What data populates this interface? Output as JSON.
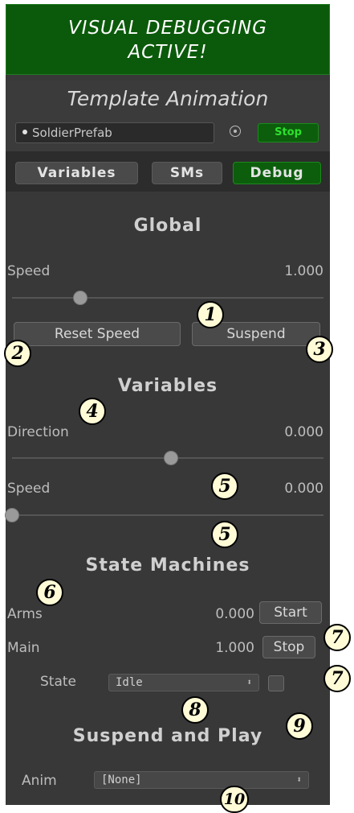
{
  "banner": {
    "line1": "VISUAL DEBUGGING",
    "line2": "ACTIVE!"
  },
  "header": {
    "title": "Template Animation",
    "object_field": "SoldierPrefab",
    "stop_label": "Stop"
  },
  "tabs": [
    {
      "label": "Variables"
    },
    {
      "label": "SMs"
    },
    {
      "label": "Debug",
      "active": true
    }
  ],
  "global": {
    "title": "Global",
    "speed_label": "Speed",
    "speed_value": "1.000",
    "speed_slider_fraction": 0.22,
    "reset_speed_label": "Reset Speed",
    "suspend_label": "Suspend"
  },
  "variables": {
    "title": "Variables",
    "items": [
      {
        "label": "Direction",
        "value": "0.000",
        "slider_fraction": 0.51
      },
      {
        "label": "Speed",
        "value": "0.000",
        "slider_fraction": 0.0
      }
    ]
  },
  "state_machines": {
    "title": "State Machines",
    "rows": [
      {
        "label": "Arms",
        "value": "0.000",
        "button": "Start"
      },
      {
        "label": "Main",
        "value": "1.000",
        "button": "Stop"
      }
    ],
    "state_label": "State",
    "state_value": "Idle"
  },
  "suspend_play": {
    "title": "Suspend and Play",
    "anim_label": "Anim",
    "anim_value": "[None]"
  },
  "callouts": [
    "1",
    "2",
    "3",
    "4",
    "5",
    "5",
    "6",
    "7",
    "7",
    "8",
    "9",
    "10"
  ],
  "colors": {
    "panel": "#383838",
    "accent_green": "#0b5a0b"
  }
}
